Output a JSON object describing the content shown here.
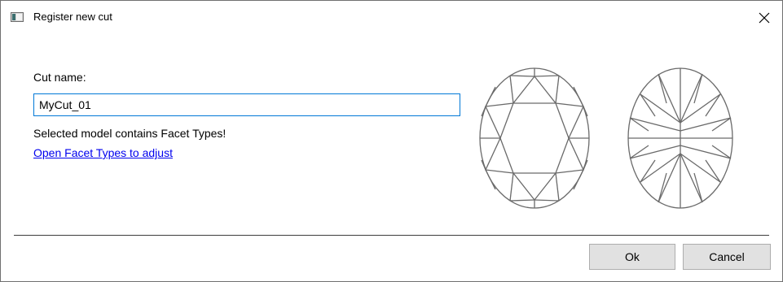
{
  "window": {
    "title": "Register new cut",
    "icon": "app-window-icon",
    "close_icon": "close-icon"
  },
  "form": {
    "cut_name_label": "Cut name:",
    "cut_name_value": "MyCut_01",
    "notice_text": "Selected model contains Facet Types!",
    "link_text": "Open Facet Types to adjust"
  },
  "preview": {
    "crown_view": "oval-crown-facet-diagram",
    "pavilion_view": "oval-pavilion-facet-diagram"
  },
  "buttons": {
    "ok_label": "Ok",
    "cancel_label": "Cancel"
  },
  "colors": {
    "link": "#0000ee",
    "input_focus_border": "#0078d7",
    "button_face": "#e1e1e1",
    "diagram_stroke": "#6a6a6a"
  }
}
